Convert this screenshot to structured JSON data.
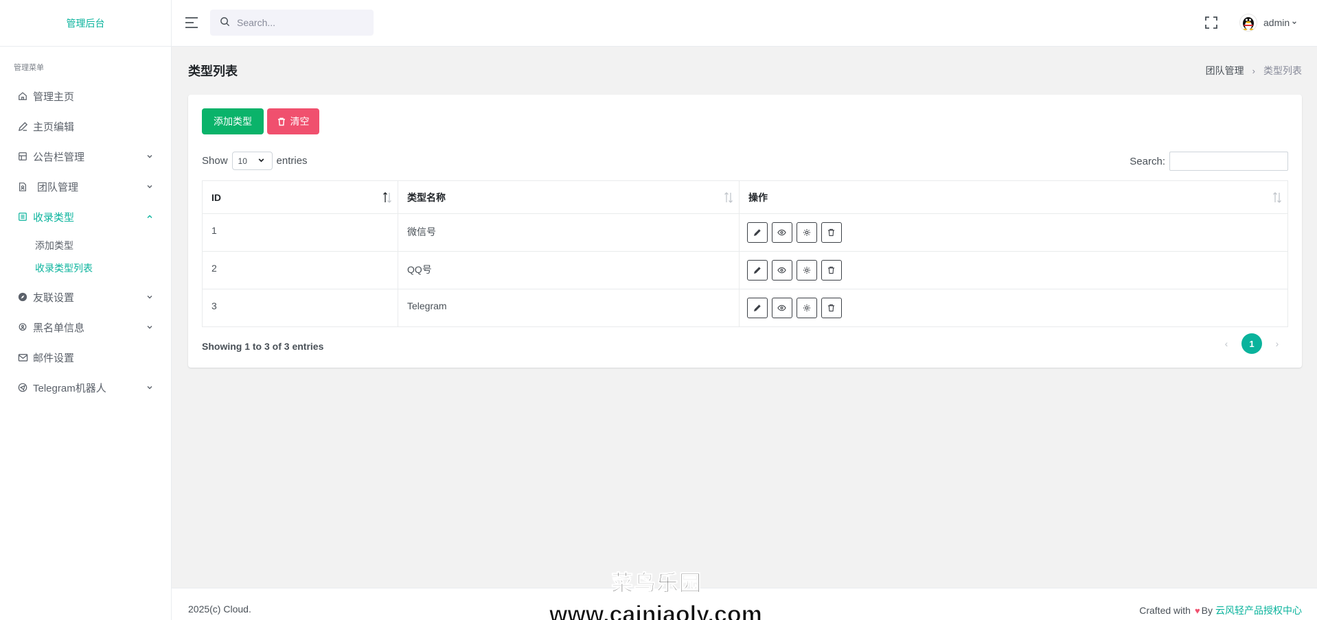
{
  "app": {
    "brand": "管理后台"
  },
  "sidebar": {
    "menu_title": "管理菜单",
    "items": [
      {
        "label": "管理主页",
        "icon": "home-icon"
      },
      {
        "label": "主页编辑",
        "icon": "pencil-icon"
      },
      {
        "label": "公告栏管理",
        "icon": "board-icon",
        "expandable": true
      },
      {
        "label": "团队管理",
        "icon": "document-user-icon",
        "expandable": true
      },
      {
        "label": "收录类型",
        "icon": "list-icon",
        "expandable": true,
        "expanded": true,
        "active": true
      },
      {
        "label": "友联设置",
        "icon": "compass-icon",
        "expandable": true
      },
      {
        "label": "黑名单信息",
        "icon": "location-icon",
        "expandable": true
      },
      {
        "label": "邮件设置",
        "icon": "mail-icon"
      },
      {
        "label": "Telegram机器人",
        "icon": "telegram-icon",
        "expandable": true
      }
    ],
    "sub_items": [
      {
        "label": "添加类型",
        "active": false
      },
      {
        "label": "收录类型列表",
        "active": true
      }
    ]
  },
  "topbar": {
    "search_placeholder": "Search...",
    "user_name": "admin"
  },
  "page": {
    "title": "类型列表",
    "breadcrumb": [
      "团队管理",
      "类型列表"
    ]
  },
  "card": {
    "add_button": "添加类型",
    "clear_button": "清空",
    "length": {
      "show_label": "Show",
      "value": "10",
      "entries_label": "entries"
    },
    "filter_label": "Search:",
    "columns": [
      "ID",
      "类型名称",
      "操作"
    ],
    "rows": [
      {
        "id": "1",
        "name": "微信号"
      },
      {
        "id": "2",
        "name": "QQ号"
      },
      {
        "id": "3",
        "name": "Telegram"
      }
    ],
    "actions": [
      "edit-icon",
      "eye-icon",
      "settings-icon",
      "trash-icon"
    ],
    "info": "Showing 1 to 3 of 3 entries",
    "pagination": {
      "prev": "‹",
      "current": "1",
      "next": "›"
    }
  },
  "footer": {
    "copyright": "2025(c) Cloud.",
    "crafted_text": "Crafted with",
    "by_text": "By",
    "link_text": "云风轻产品授权中心"
  },
  "watermark": {
    "line1": "菜鸟乐园",
    "line2": "www.cainiaoly.com"
  },
  "colors": {
    "accent": "#0ab39c",
    "add_button": "#0ab36a",
    "clear_button": "#f0506e"
  }
}
